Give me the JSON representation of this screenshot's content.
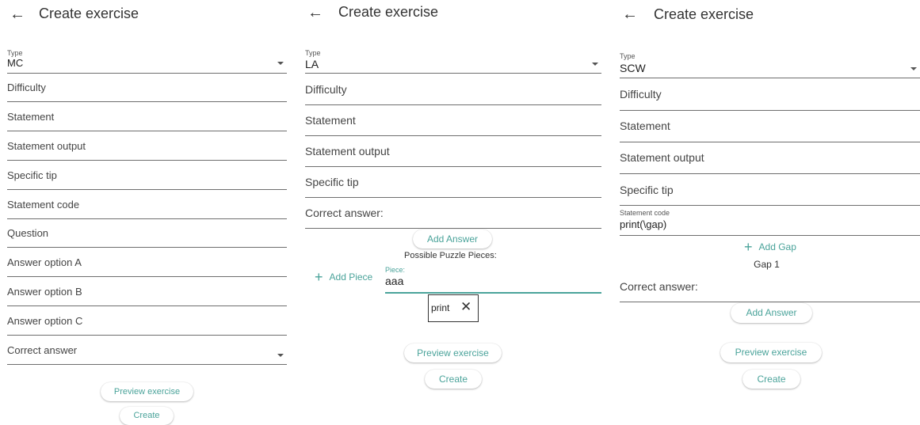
{
  "panel1": {
    "title": "Create exercise",
    "type_label": "Type",
    "type_value": "MC",
    "fields": [
      "Difficulty",
      "Statement",
      "Statement output",
      "Specific tip",
      "Statement code",
      "Question",
      "Answer option A",
      "Answer option B",
      "Answer option C"
    ],
    "correct_answer": "Correct answer",
    "preview_label": "Preview exercise",
    "create_label": "Create"
  },
  "panel2": {
    "title": "Create exercise",
    "type_label": "Type",
    "type_value": "LA",
    "fields": [
      "Difficulty",
      "Statement",
      "Statement output",
      "Specific tip",
      "Correct answer:"
    ],
    "add_answer_label": "Add Answer",
    "possible_pieces_label": "Possible Puzzle Pieces:",
    "add_piece_label": "Add Piece",
    "piece_label": "Piece:",
    "piece_value": "aaa",
    "chip_label": "print",
    "preview_label": "Preview exercise",
    "create_label": "Create"
  },
  "panel3": {
    "title": "Create exercise",
    "type_label": "Type",
    "type_value": "SCW",
    "fields": [
      "Difficulty",
      "Statement",
      "Statement output",
      "Specific tip"
    ],
    "statement_code_label": "Statement code",
    "statement_code_value": "print(\\gap)",
    "add_gap_label": "Add Gap",
    "gap_label": "Gap 1",
    "correct_answer": "Correct answer:",
    "add_answer_label": "Add Answer",
    "preview_label": "Preview exercise",
    "create_label": "Create"
  },
  "icons": {
    "back": "arrow-left-icon",
    "add": "plus-icon",
    "close": "close-icon",
    "dropdown": "caret-down-icon"
  },
  "colors": {
    "accent": "#4aa39a",
    "underline": "#6e6e6e",
    "text": "#333333"
  }
}
